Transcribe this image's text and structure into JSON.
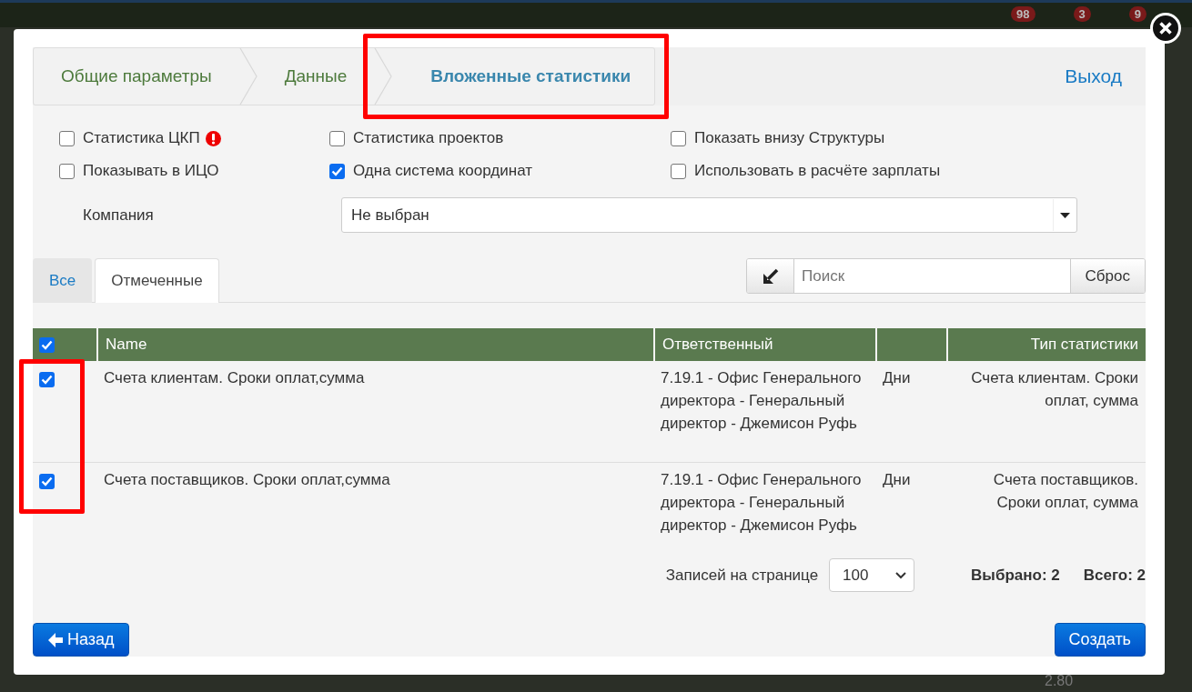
{
  "background": {
    "badges": [
      "98",
      "3",
      "9"
    ],
    "axis_label": "2.80"
  },
  "wizard": {
    "steps": [
      {
        "label": "Общие параметры",
        "selected": false,
        "highlighted": false
      },
      {
        "label": "Данные",
        "selected": false,
        "highlighted": false
      },
      {
        "label": "Вложенные статистики",
        "selected": true,
        "highlighted": true
      }
    ],
    "exit_link": "Выход"
  },
  "options": [
    {
      "label": "Статистика ЦКП",
      "checked": false,
      "warning": true
    },
    {
      "label": "Статистика проектов",
      "checked": false
    },
    {
      "label": "Показать внизу Структуры",
      "checked": false
    },
    {
      "label": "Показывать в ИЦО",
      "checked": false
    },
    {
      "label": "Одна система координат",
      "checked": true
    },
    {
      "label": "Использовать в расчёте зарплаты",
      "checked": false
    }
  ],
  "company": {
    "label": "Компания",
    "value": "Не выбран"
  },
  "tabs": [
    {
      "label": "Все",
      "selected": false
    },
    {
      "label": "Отмеченные",
      "selected": true
    }
  ],
  "search": {
    "placeholder": "Поиск",
    "reset": "Сброс"
  },
  "table": {
    "all_checked": true,
    "checkbox_column_highlighted": true,
    "columns": [
      "Name",
      "Ответственный",
      "",
      "Тип статистики"
    ],
    "rows": [
      {
        "checked": true,
        "name": "Счета клиентам. Сроки оплат,сумма",
        "owner": "7.19.1 - Офис Генерального директора - Генеральный директор - Джемисон Руфь",
        "period": "Дни",
        "type": "Счета клиентам. Сроки оплат, сумма"
      },
      {
        "checked": true,
        "name": "Счета поставщиков. Сроки оплат,сумма",
        "owner": "7.19.1 - Офис Генерального директора - Генеральный директор - Джемисон Руфь",
        "period": "Дни",
        "type": "Счета поставщиков. Сроки оплат, сумма"
      }
    ]
  },
  "pager": {
    "label": "Записей на странице",
    "page_size": "100",
    "selected": "Выбрано: 2",
    "total": "Всего: 2"
  },
  "buttons": {
    "back": "Назад",
    "create": "Создать"
  }
}
